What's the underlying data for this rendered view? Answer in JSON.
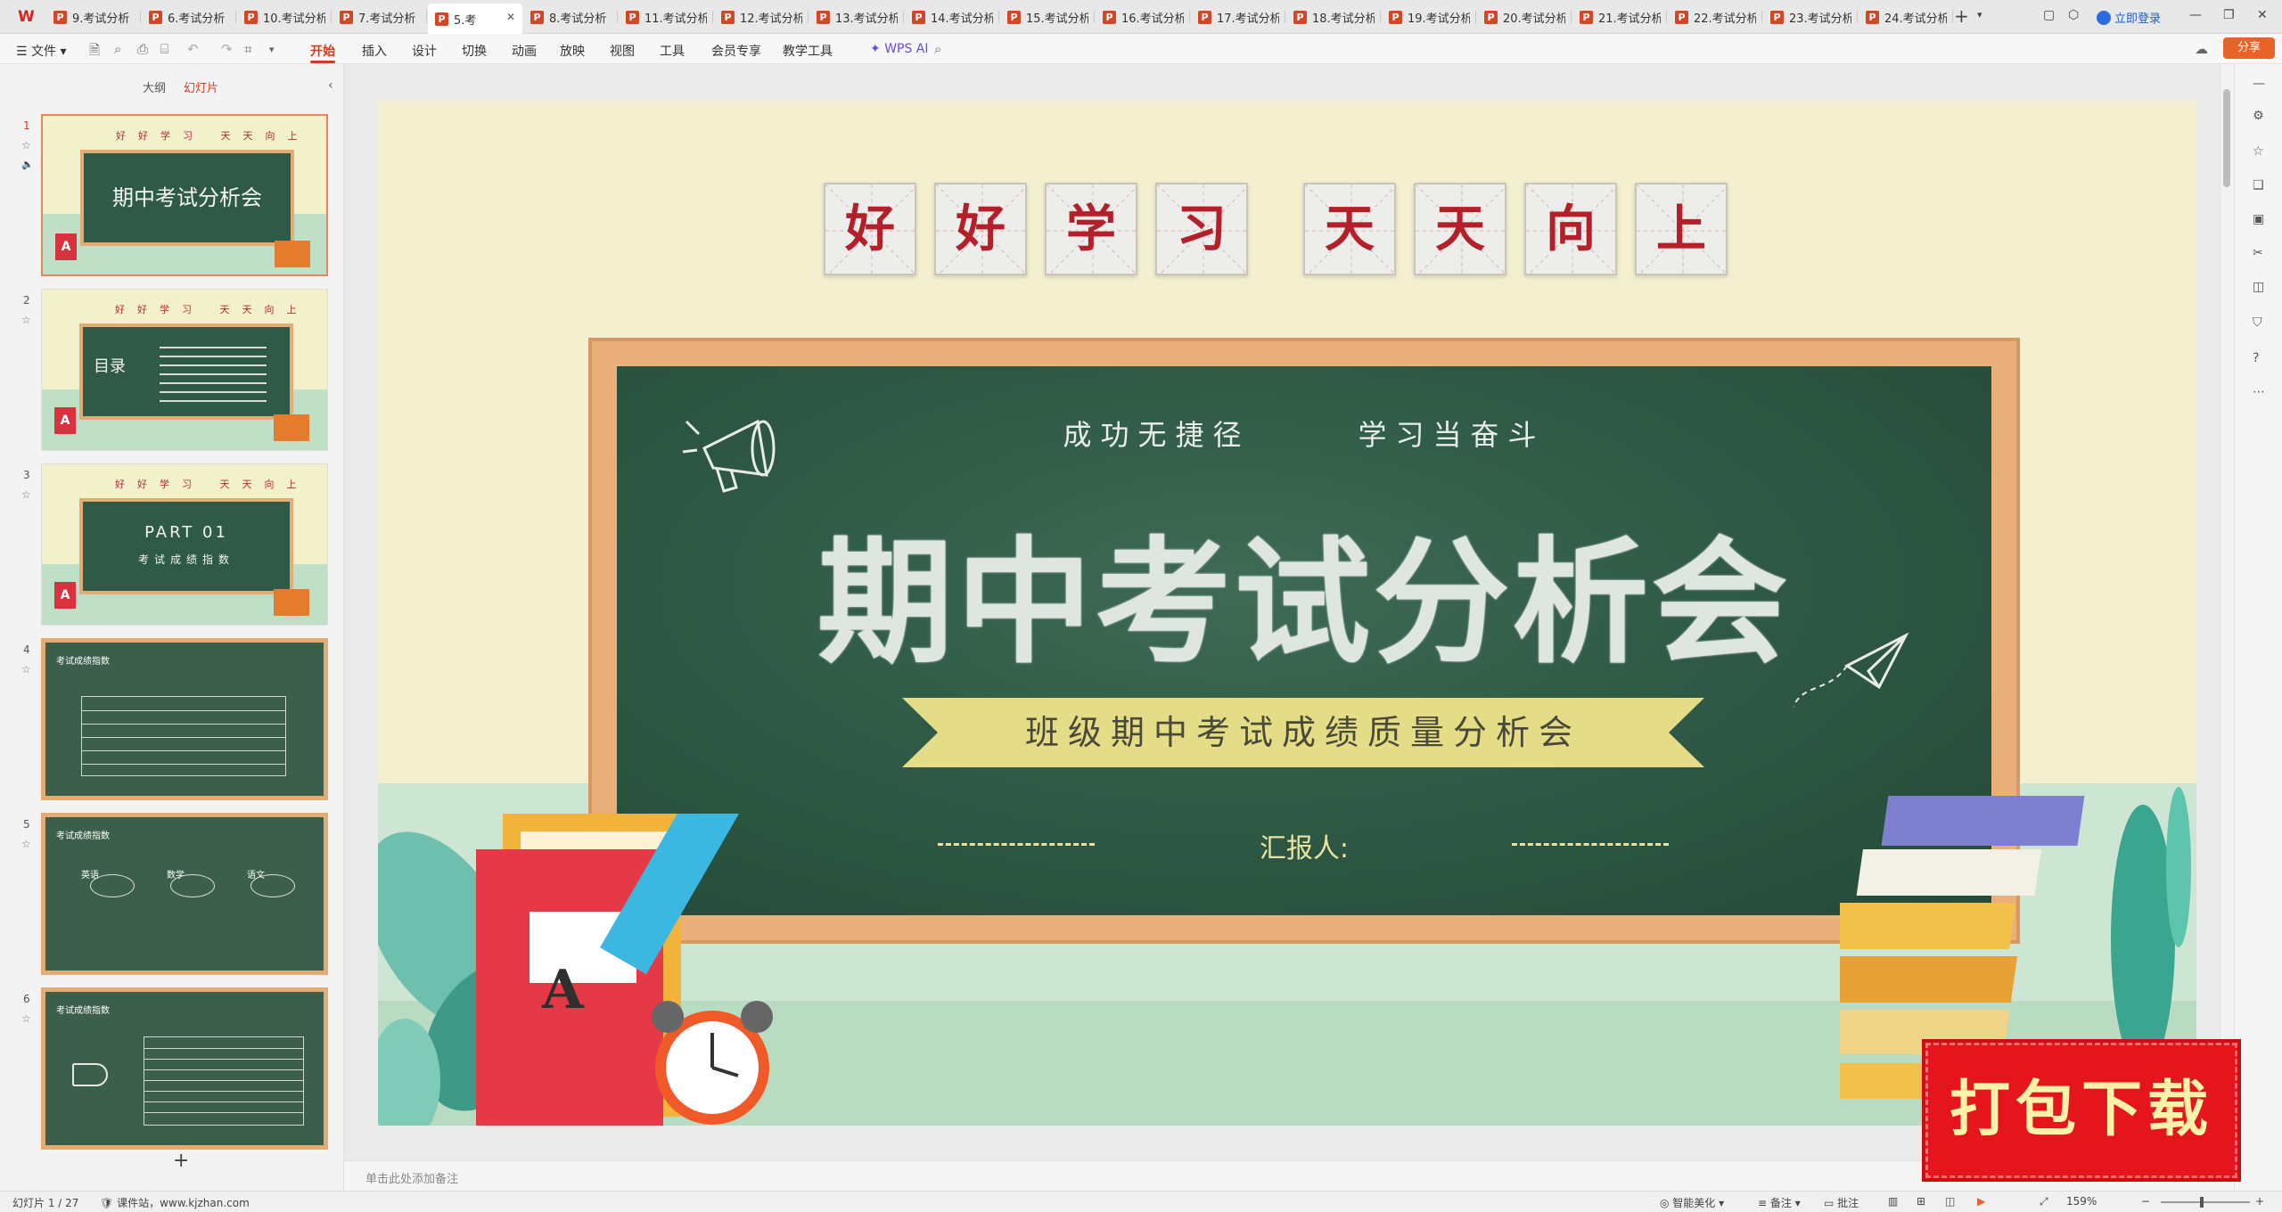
{
  "app": {
    "logo_text": "W"
  },
  "tabs": [
    {
      "label": "9.考试分析",
      "active": false
    },
    {
      "label": "6.考试分析",
      "active": false
    },
    {
      "label": "10.考试分析",
      "active": false
    },
    {
      "label": "7.考试分析",
      "active": false
    },
    {
      "label": "5.考",
      "active": true
    },
    {
      "label": "8.考试分析",
      "active": false
    },
    {
      "label": "11.考试分析",
      "active": false
    },
    {
      "label": "12.考试分析",
      "active": false
    },
    {
      "label": "13.考试分析",
      "active": false
    },
    {
      "label": "14.考试分析",
      "active": false
    },
    {
      "label": "15.考试分析",
      "active": false
    },
    {
      "label": "16.考试分析",
      "active": false
    },
    {
      "label": "17.考试分析",
      "active": false
    },
    {
      "label": "18.考试分析",
      "active": false
    },
    {
      "label": "19.考试分析",
      "active": false
    },
    {
      "label": "20.考试分析",
      "active": false
    },
    {
      "label": "21.考试分析",
      "active": false
    },
    {
      "label": "22.考试分析",
      "active": false
    },
    {
      "label": "23.考试分析",
      "active": false
    },
    {
      "label": "24.考试分析",
      "active": false
    }
  ],
  "account": {
    "login_label": "立即登录"
  },
  "menu": {
    "file": "文件",
    "items": [
      "开始",
      "插入",
      "设计",
      "切换",
      "动画",
      "放映",
      "视图",
      "工具",
      "会员专享",
      "教学工具"
    ],
    "active": "开始",
    "wps_ai": "WPS AI",
    "share": "分享"
  },
  "left_panel": {
    "tabs": [
      "大纲",
      "幻灯片"
    ],
    "active_tab": "幻灯片",
    "thumbnails": [
      {
        "number": "1",
        "chars": "好好学习 天天向上",
        "title": "期中考试分析会"
      },
      {
        "number": "2",
        "chars": "好好学习 天天向上",
        "title": "目录"
      },
      {
        "number": "3",
        "chars": "好好学习 天天向上",
        "title": "PART 01",
        "subtitle": "考试成绩指数"
      },
      {
        "number": "4",
        "heading": "考试成绩指数"
      },
      {
        "number": "5",
        "heading": "考试成绩指数",
        "labels": [
          "英语",
          "数学",
          "语文"
        ]
      },
      {
        "number": "6",
        "heading": "考试成绩指数"
      }
    ]
  },
  "slide": {
    "chars_left": [
      "好",
      "好",
      "学",
      "习"
    ],
    "chars_right": [
      "天",
      "天",
      "向",
      "上"
    ],
    "subtitle": "成功无捷径      学习当奋斗",
    "title": "期中考试分析会",
    "banner": "班级期中考试成绩质量分析会",
    "reporter": "汇报人:",
    "book_letter": "A"
  },
  "notes": {
    "placeholder": "单击此处添加备注"
  },
  "status": {
    "slide_info": "幻灯片 1 / 27",
    "source": "课件站，www.kjzhan.com",
    "beautify": "智能美化",
    "notes": "备注",
    "comments": "批注",
    "zoom": "159%"
  },
  "badge": {
    "text": "打包下载"
  },
  "colors": {
    "accent": "#d13c20",
    "board": "#2f5a46",
    "frame": "#e9b07c",
    "slide_bg": "#f3efcf"
  }
}
